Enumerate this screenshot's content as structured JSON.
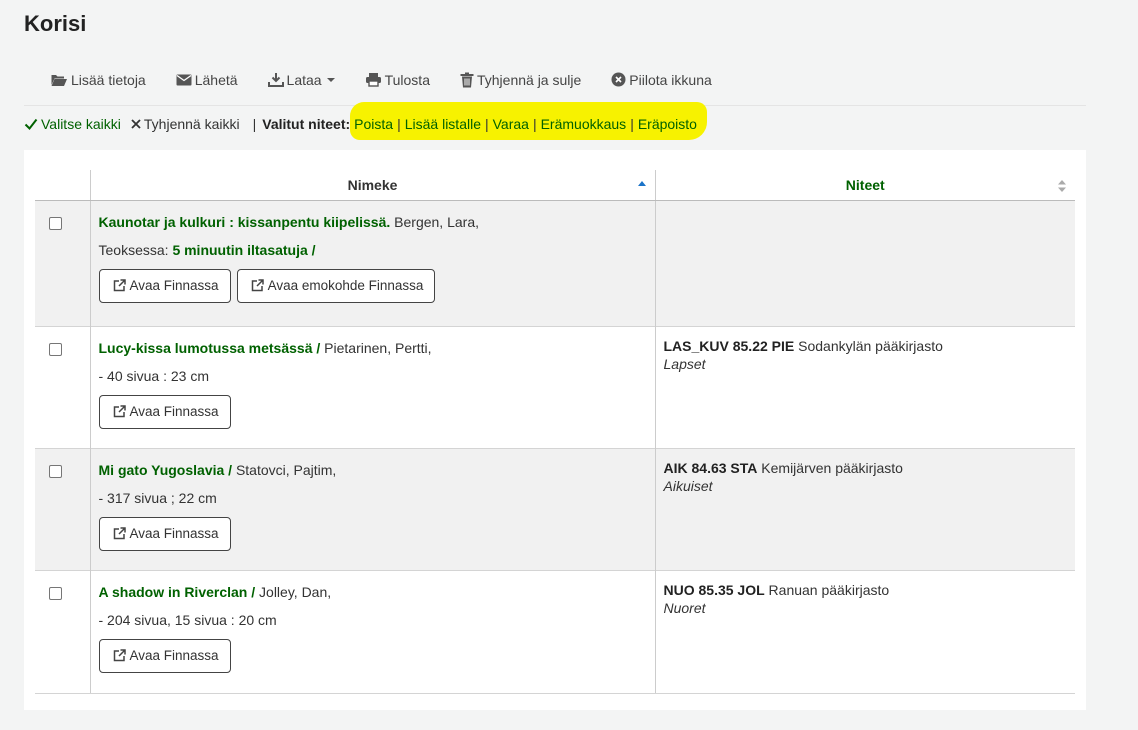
{
  "page": {
    "title": "Korisi"
  },
  "toolbar": {
    "add_info": "Lisää tietoja",
    "send": "Lähetä",
    "download": "Lataa",
    "print": "Tulosta",
    "empty_close": "Tyhjennä ja sulje",
    "hide_window": "Piilota ikkuna"
  },
  "selection": {
    "select_all": "Valitse kaikki",
    "clear_all": "Tyhjennä kaikki",
    "selected_label": "Valitut niteet:",
    "actions": [
      "Poista",
      "Lisää listalle",
      "Varaa",
      "Erämuokkaus",
      "Eräpoisto"
    ],
    "highlight_color": "#f7f200"
  },
  "table": {
    "headers": {
      "title": "Nimeke",
      "items": "Niteet"
    },
    "rows": [
      {
        "title": "Kaunotar ja kulkuri : kissanpentu kiipelissä.",
        "author": "Bergen, Lara,",
        "part_prefix": "Teoksessa:",
        "part_title": "5 minuutin iltasatuja /",
        "buttons": [
          "Avaa Finnassa",
          "Avaa emokohde Finnassa"
        ],
        "callnumber": "",
        "branch": "",
        "location": ""
      },
      {
        "title": "Lucy-kissa lumotussa metsässä /",
        "author": "Pietarinen, Pertti,",
        "physical": "- 40 sivua : 23 cm",
        "buttons": [
          "Avaa Finnassa"
        ],
        "callnumber": "LAS_KUV 85.22 PIE",
        "branch": "Sodankylän pääkirjasto",
        "location": "Lapset"
      },
      {
        "title": "Mi gato Yugoslavia /",
        "author": "Statovci, Pajtim,",
        "physical": "- 317 sivua ; 22 cm",
        "buttons": [
          "Avaa Finnassa"
        ],
        "callnumber": "AIK 84.63 STA",
        "branch": "Kemijärven pääkirjasto",
        "location": "Aikuiset"
      },
      {
        "title": "A shadow in Riverclan /",
        "author": "Jolley, Dan,",
        "physical": "- 204 sivua, 15 sivua : 20 cm",
        "buttons": [
          "Avaa Finnassa"
        ],
        "callnumber": "NUO 85.35 JOL",
        "branch": "Ranuan pääkirjasto",
        "location": "Nuoret"
      }
    ]
  },
  "colors": {
    "accent_green": "#006100",
    "sort_active": "#1a73c8"
  }
}
